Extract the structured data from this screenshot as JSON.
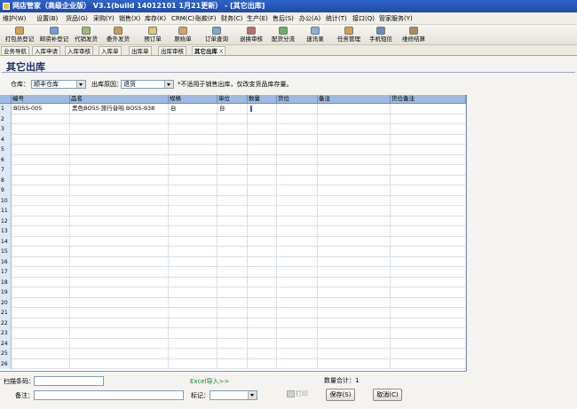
{
  "window": {
    "title": "网店管家（高级企业版） V3.1(build 14012101 1月21更新） - [其它出库]"
  },
  "menu": [
    "维护(W)",
    "设置(B)",
    "货品(G)",
    "采购(Y)",
    "销售(X)",
    "库存(K)",
    "CRM(C)",
    "账款(F)",
    "财务(C)",
    "生产(E)",
    "售后(S)",
    "办公(A)",
    "统计(T)",
    "接口(Q)",
    "管家服务(Y)"
  ],
  "toolbar": {
    "items": [
      {
        "label": "打包员登记",
        "icon": "package-icon",
        "color": "#d6a54a"
      },
      {
        "label": "邮资补登记",
        "icon": "postage-icon",
        "color": "#6aa0d8"
      },
      {
        "label": "代销发货",
        "icon": "consign-icon",
        "color": "#9bbd6a"
      },
      {
        "label": "委外发货",
        "icon": "outsource-icon",
        "color": "#c79a5a"
      },
      {
        "label": "预订单",
        "icon": "order-icon",
        "color": "#e2c870"
      },
      {
        "label": "原始单",
        "icon": "original-order-icon",
        "color": "#d9a35a"
      },
      {
        "label": "订单查询",
        "icon": "search-icon",
        "color": "#7aa6d4"
      },
      {
        "label": "退换审核",
        "icon": "return-icon",
        "color": "#c06a6a"
      },
      {
        "label": "配货分流",
        "icon": "distribute-icon",
        "color": "#6ab06a"
      },
      {
        "label": "速讯录",
        "icon": "contacts-icon",
        "color": "#8ab0d8"
      },
      {
        "label": "任务管理",
        "icon": "task-icon",
        "color": "#d8a040"
      },
      {
        "label": "手机短信",
        "icon": "phone-icon",
        "color": "#6a8ac8"
      },
      {
        "label": "维修结算",
        "icon": "repair-icon",
        "color": "#b08a60"
      }
    ]
  },
  "tabs": [
    "业务导航",
    "入库申请",
    "入库审核",
    "入库单",
    "出库单",
    "出库审核",
    "其它出库"
  ],
  "tab_close": "X",
  "page": {
    "title": "其它出库",
    "warehouse_label": "仓库：",
    "warehouse_value": "顺丰仓库",
    "reason_label": "出库原因：",
    "reason_value": "退货",
    "note": "*不适用于销售出库，仅改变货品库存量。"
  },
  "grid": {
    "columns": [
      "编号",
      "品名",
      "规格",
      "单位",
      "数量",
      "货位",
      "备注",
      "货位备注"
    ],
    "rows": [
      {
        "num": "1",
        "code": "BOSS-005",
        "name": "黑色BOSS 旅行音响 BOSS-938",
        "spec": "台",
        "unit": "台",
        "qty": "",
        "loc": "",
        "remark": "",
        "loc_remark": ""
      }
    ],
    "row_count": 26
  },
  "footer": {
    "scan_label": "扫描条码：",
    "excel_link": "Excel导入>>",
    "qty_total": "数量合计：1",
    "remark_label": "备注：",
    "mark_label": "标记：",
    "print_btn": "打印",
    "save_btn": "保存(S)",
    "cancel_btn": "取消(C)"
  }
}
